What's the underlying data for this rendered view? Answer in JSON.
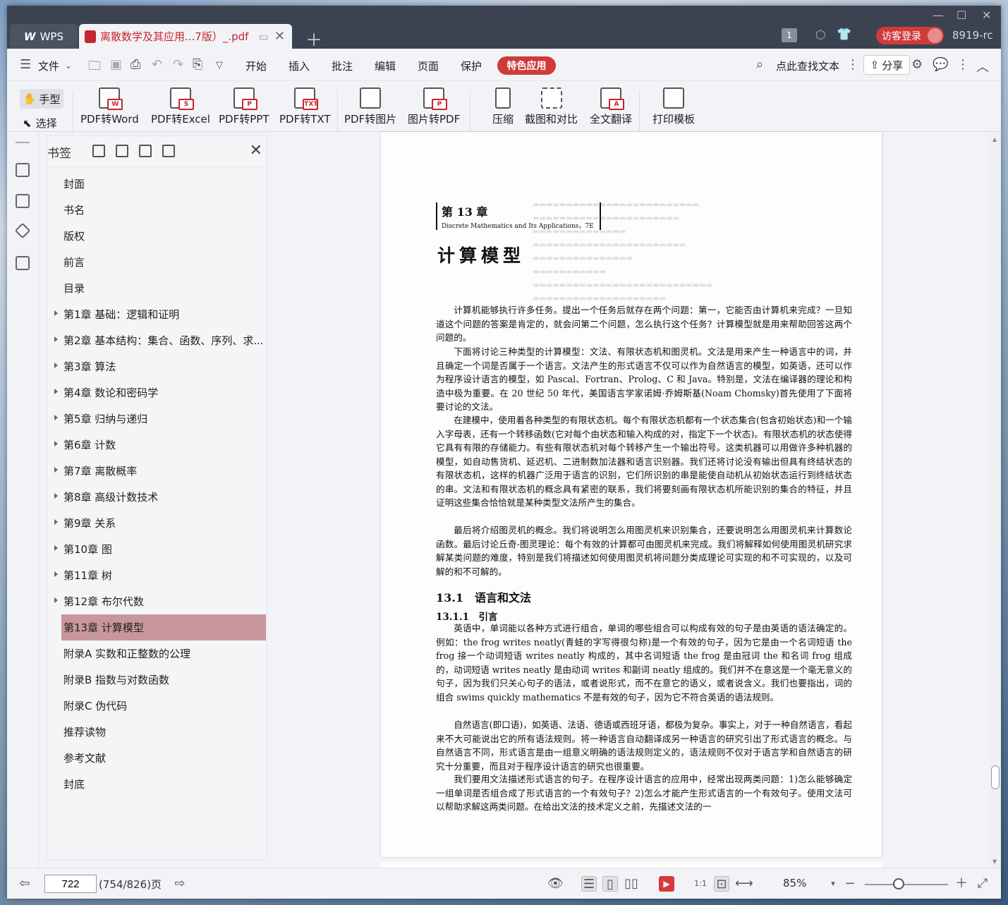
{
  "titlebar": {
    "app_tab": "WPS",
    "doc_tab": "离散数学及其应用...7版）_.pdf",
    "login": "访客登录",
    "user": "8919-rc",
    "count_badge": "1"
  },
  "menubar": {
    "file": "文件",
    "items": [
      "开始",
      "插入",
      "批注",
      "编辑",
      "页面",
      "保护"
    ],
    "special": "特色应用",
    "search": "点此查找文本",
    "share": "分享"
  },
  "ribbon": {
    "hand": "手型",
    "select": "选择",
    "tools": [
      {
        "label": "PDF转Word",
        "icon": "pdf-to-word-icon",
        "badge": "W"
      },
      {
        "label": "PDF转Excel",
        "icon": "pdf-to-excel-icon",
        "badge": "S"
      },
      {
        "label": "PDF转PPT",
        "icon": "pdf-to-ppt-icon",
        "badge": "P"
      },
      {
        "label": "PDF转TXT",
        "icon": "pdf-to-txt-icon",
        "badge": "TXT"
      },
      {
        "label": "PDF转图片",
        "icon": "pdf-to-image-icon",
        "badge": ""
      },
      {
        "label": "图片转PDF",
        "icon": "image-to-pdf-icon",
        "badge": "P"
      },
      {
        "label": "压缩",
        "icon": "compress-icon",
        "badge": ""
      },
      {
        "label": "截图和对比",
        "icon": "screenshot-compare-icon",
        "badge": ""
      },
      {
        "label": "全文翻译",
        "icon": "translate-icon",
        "badge": "A"
      },
      {
        "label": "打印模板",
        "icon": "print-template-icon",
        "badge": ""
      }
    ]
  },
  "bookmarks": {
    "title": "书签",
    "items": [
      {
        "label": "封面",
        "expandable": false
      },
      {
        "label": "书名",
        "expandable": false
      },
      {
        "label": "版权",
        "expandable": false
      },
      {
        "label": "前言",
        "expandable": false
      },
      {
        "label": "目录",
        "expandable": false
      },
      {
        "label": "第1章 基础：逻辑和证明",
        "expandable": true
      },
      {
        "label": "第2章 基本结构：集合、函数、序列、求...",
        "expandable": true
      },
      {
        "label": "第3章 算法",
        "expandable": true
      },
      {
        "label": "第4章 数论和密码学",
        "expandable": true
      },
      {
        "label": "第5章 归纳与递归",
        "expandable": true
      },
      {
        "label": "第6章 计数",
        "expandable": true
      },
      {
        "label": "第7章 离散概率",
        "expandable": true
      },
      {
        "label": "第8章 高级计数技术",
        "expandable": true
      },
      {
        "label": "第9章 关系",
        "expandable": true
      },
      {
        "label": "第10章 图",
        "expandable": true
      },
      {
        "label": "第11章 树",
        "expandable": true
      },
      {
        "label": "第12章 布尔代数",
        "expandable": true
      },
      {
        "label": "第13章 计算模型",
        "expandable": true,
        "selected": true
      },
      {
        "label": "附录A 实数和正整数的公理",
        "expandable": false
      },
      {
        "label": "附录B 指数与对数函数",
        "expandable": false
      },
      {
        "label": "附录C 伪代码",
        "expandable": false
      },
      {
        "label": "推荐读物",
        "expandable": false
      },
      {
        "label": "参考文献",
        "expandable": false
      },
      {
        "label": "封底",
        "expandable": false
      }
    ]
  },
  "document": {
    "chapter_label": "第 13 章",
    "book_ref": "Discrete Mathematics and Its Applications，7E",
    "chapter_title": "计算模型",
    "paragraphs": [
      "计算机能够执行许多任务。提出一个任务后就存在两个问题：第一，它能否由计算机来完成？一旦知道这个问题的答案是肯定的，就会问第二个问题，怎么执行这个任务？计算模型就是用来帮助回答这两个问题的。",
      "下面将讨论三种类型的计算模型：文法、有限状态机和图灵机。文法是用来产生一种语言中的词，并且确定一个词是否属于一个语言。文法产生的形式语言不仅可以作为自然语言的模型，如英语，还可以作为程序设计语言的模型，如 Pascal、Fortran、Prolog、C 和 Java。特别是，文法在编译器的理论和构造中极为重要。在 20 世纪 50 年代，美国语言学家诺姆·乔姆斯基(Noam Chomsky)首先使用了下面将要讨论的文法。",
      "在建模中，使用着各种类型的有限状态机。每个有限状态机都有一个状态集合(包含初始状态)和一个输入字母表，还有一个转移函数(它对每个由状态和输入构成的对，指定下一个状态)。有限状态机的状态使得它具有有限的存储能力。有些有限状态机对每个转移产生一个输出符号。这类机器可以用做许多种机器的模型，如自动售货机、延迟机、二进制数加法器和语言识别器。我们还将讨论没有输出但具有终结状态的有限状态机，这样的机器广泛用于语言的识别，它们所识别的串是能使自动机从初始状态运行到终结状态的串。文法和有限状态机的概念具有紧密的联系，我们将要刻画有限状态机所能识别的集合的特征，并且证明这些集合恰恰就是某种类型文法所产生的集合。",
      "最后将介绍图灵机的概念。我们将说明怎么用图灵机来识别集合，还要说明怎么用图灵机来计算数论函数。最后讨论丘奇-图灵理论：每个有效的计算都可由图灵机来完成。我们将解释如何使用图灵机研究求解某类问题的难度，特别是我们将描述如何使用图灵机将问题分类成理论可实现的和不可实现的，以及可解的和不可解的。"
    ],
    "section_heading": "13.1　语言和文法",
    "subsection_heading": "13.1.1　引言",
    "section_paragraphs": [
      "英语中，单词能以各种方式进行组合，单词的哪些组合可以构成有效的句子是由英语的语法确定的。例如：the frog writes neatly(青蛙的字写得很匀称)是一个有效的句子，因为它是由一个名词短语 the frog 接一个动词短语 writes neatly 构成的，其中名词短语 the frog 是由冠词 the 和名词 frog 组成的，动词短语 writes neatly 是由动词 writes 和副词 neatly 组成的。我们并不在意这是一个毫无意义的句子，因为我们只关心句子的语法，或者说形式，而不在意它的语义，或者说含义。我们也要指出，词的组合 swims quickly mathematics 不是有效的句子，因为它不符合英语的语法规则。",
      "自然语言(即口语)，如英语、法语、德语或西班牙语，都极为复杂。事实上，对于一种自然语言，看起来不大可能说出它的所有语法规则。将一种语言自动翻译成另一种语言的研究引出了形式语言的概念。与自然语言不同，形式语言是由一组意义明确的语法规则定义的，语法规则不仅对于语言学和自然语言的研究十分重要，而且对于程序设计语言的研究也很重要。",
      "我们要用文法描述形式语言的句子。在程序设计语言的应用中，经常出现两类问题：1)怎么能够确定一组单词是否组合成了形式语言的一个有效句子？2)怎么才能产生形式语言的一个有效句子。使用文法可以帮助求解这两类问题。在给出文法的技术定义之前，先描述文法的一"
    ]
  },
  "statusbar": {
    "page_input": "722",
    "page_info": "(754/826)页",
    "zoom": "85%"
  }
}
